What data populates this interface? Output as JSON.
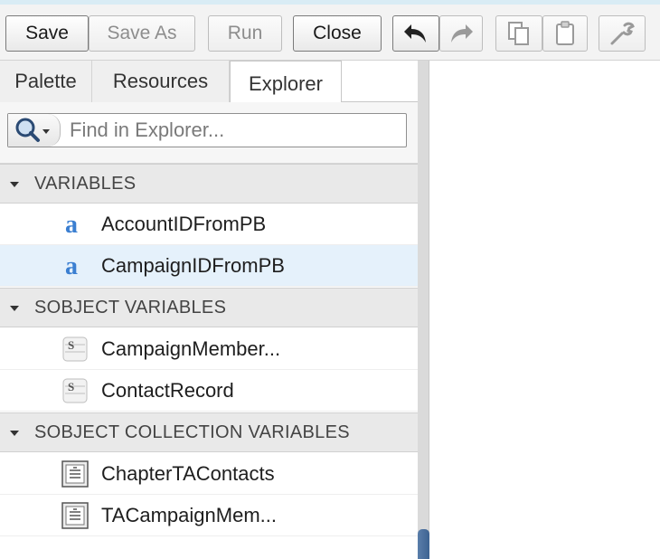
{
  "toolbar": {
    "save_label": "Save",
    "save_as_label": "Save As",
    "run_label": "Run",
    "close_label": "Close",
    "undo_icon": "undo-icon",
    "redo_icon": "redo-icon",
    "copy_icon": "copy-icon",
    "paste_icon": "paste-icon",
    "settings_icon": "wrench-icon"
  },
  "tabs": [
    {
      "label": "Palette",
      "active": false
    },
    {
      "label": "Resources",
      "active": false
    },
    {
      "label": "Explorer",
      "active": true
    }
  ],
  "search": {
    "placeholder": "Find in Explorer...",
    "value": "",
    "icon": "magnifier-icon"
  },
  "sections": [
    {
      "title": "VARIABLES",
      "items": [
        {
          "label": "AccountIDFromPB",
          "icon": "text-variable-icon",
          "selected": false
        },
        {
          "label": "CampaignIDFromPB",
          "icon": "text-variable-icon",
          "selected": true
        }
      ]
    },
    {
      "title": "SOBJECT VARIABLES",
      "items": [
        {
          "label": "CampaignMember...",
          "icon": "sobject-icon",
          "selected": false
        },
        {
          "label": "ContactRecord",
          "icon": "sobject-icon",
          "selected": false
        }
      ]
    },
    {
      "title": "SOBJECT COLLECTION VARIABLES",
      "items": [
        {
          "label": "ChapterTAContacts",
          "icon": "collection-icon",
          "selected": false
        },
        {
          "label": "TACampaignMem...",
          "icon": "collection-icon",
          "selected": false
        }
      ]
    }
  ],
  "colors": {
    "selected_row": "#e5f1fb",
    "section_header": "#e9e9e9",
    "scroll_thumb": "#4a6f9c"
  }
}
